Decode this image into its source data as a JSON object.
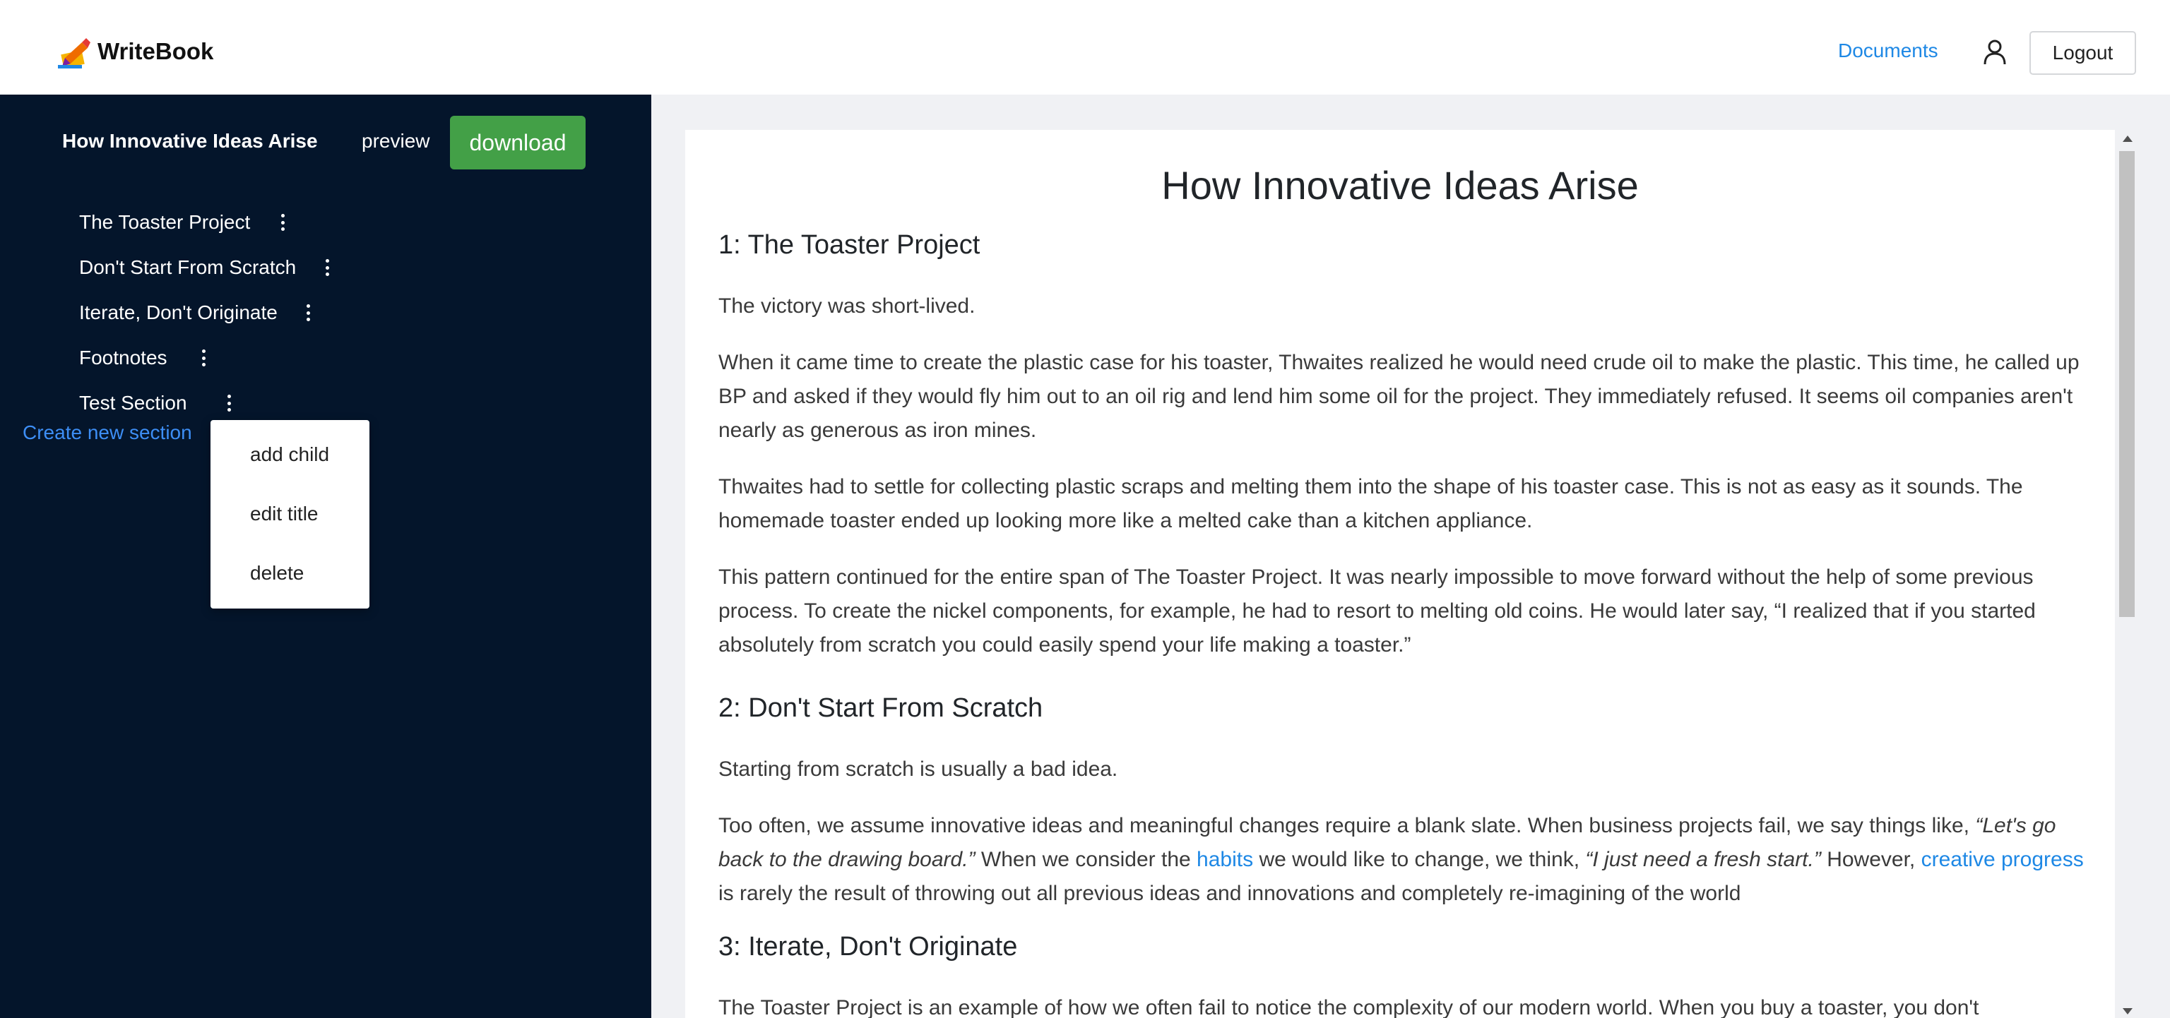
{
  "header": {
    "brand": "WriteBook",
    "nav_documents": "Documents",
    "logout": "Logout"
  },
  "sidebar": {
    "doc_title": "How Innovative Ideas Arise",
    "preview": "preview",
    "download": "download",
    "sections": [
      {
        "label": "The Toaster Project"
      },
      {
        "label": "Don't Start From Scratch"
      },
      {
        "label": "Iterate, Don't Originate"
      },
      {
        "label": "Footnotes"
      },
      {
        "label": "Test Section"
      }
    ],
    "create_new_section": "Create new section"
  },
  "context_menu": {
    "items": [
      "add child",
      "edit title",
      "delete"
    ]
  },
  "content": {
    "title": "How Innovative Ideas Arise",
    "sec1_heading": "1: The Toaster Project",
    "sec1_p1": "The victory was short-lived.",
    "sec1_p2": "When it came time to create the plastic case for his toaster, Thwaites realized he would need crude oil to make the plastic. This time, he called up BP and asked if they would fly him out to an oil rig and lend him some oil for the project. They immediately refused. It seems oil companies aren't nearly as generous as iron mines.",
    "sec1_p3": "Thwaites had to settle for collecting plastic scraps and melting them into the shape of his toaster case. This is not as easy as it sounds. The homemade toaster ended up looking more like a melted cake than a kitchen appliance.",
    "sec1_p4": "This pattern continued for the entire span of The Toaster Project. It was nearly impossible to move forward without the help of some previous process. To create the nickel components, for example, he had to resort to melting old coins. He would later say, “I realized that if you started absolutely from scratch you could easily spend your life making a toaster.”",
    "sec2_heading": "2: Don't Start From Scratch",
    "sec2_p1": "Starting from scratch is usually a bad idea.",
    "sec2_p2": {
      "a": "Too often, we assume innovative ideas and meaningful changes require a blank slate. When business projects fail, we say things like, ",
      "b": "“Let's go back to the drawing board.”",
      "c": " When we consider the ",
      "d": "habits",
      "e": " we would like to change, we think, ",
      "f": "“I just need a fresh start.”",
      "g": " However, ",
      "h": "creative progress",
      "i": " is rarely the result of throwing out all previous ideas and innovations and completely re-imagining of the world"
    },
    "sec3_heading": "3: Iterate, Don't Originate",
    "sec3_p1": "The Toaster Project is an example of how we often fail to notice the complexity of our modern world. When you buy a toaster, you don't"
  },
  "colors": {
    "sidebar_bg": "#04152b",
    "accent_green": "#43a047",
    "link_blue": "#1e88e5"
  }
}
